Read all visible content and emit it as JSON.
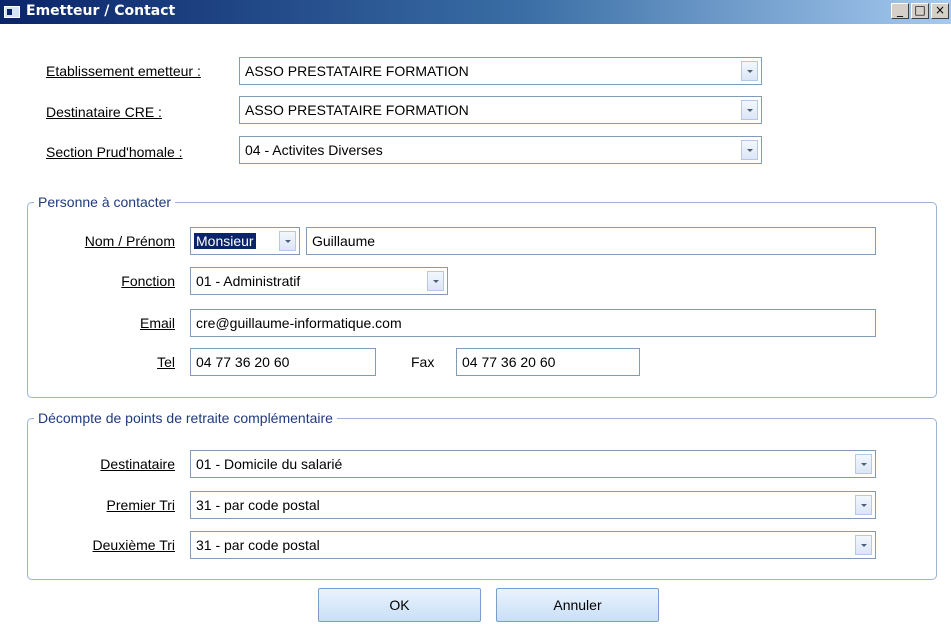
{
  "window": {
    "title": "Emetteur / Contact",
    "controls": [
      "_",
      "□",
      "×"
    ]
  },
  "etablissement": {
    "label": "Etablissement emetteur :",
    "value": "ASSO PRESTATAIRE FORMATION"
  },
  "destinataire_cre": {
    "label": "Destinataire CRE :",
    "value": "ASSO PRESTATAIRE FORMATION"
  },
  "section": {
    "label": "Section Prud'homale :",
    "value": "04 - Activites Diverses"
  },
  "contact": {
    "legend": "Personne à contacter",
    "nom_label": "Nom / Prénom",
    "civilite": "Monsieur",
    "prenom": "Guillaume",
    "fonction_label": "Fonction",
    "fonction": "01 - Administratif",
    "email_label": "Email",
    "email": "cre@guillaume-informatique.com",
    "tel_label": "Tel",
    "tel": "04 77 36 20 60",
    "fax_label": "Fax",
    "fax": "04 77 36 20 60"
  },
  "decompte": {
    "legend": "Décompte de points de retraite complémentaire",
    "destinataire_label": "Destinataire",
    "destinataire": "01 - Domicile du salarié",
    "premier_label": "Premier Tri",
    "premier": "31 - par code postal",
    "deuxieme_label": "Deuxième Tri",
    "deuxieme": "31 - par code postal"
  },
  "buttons": {
    "ok": "OK",
    "cancel": "Annuler"
  }
}
